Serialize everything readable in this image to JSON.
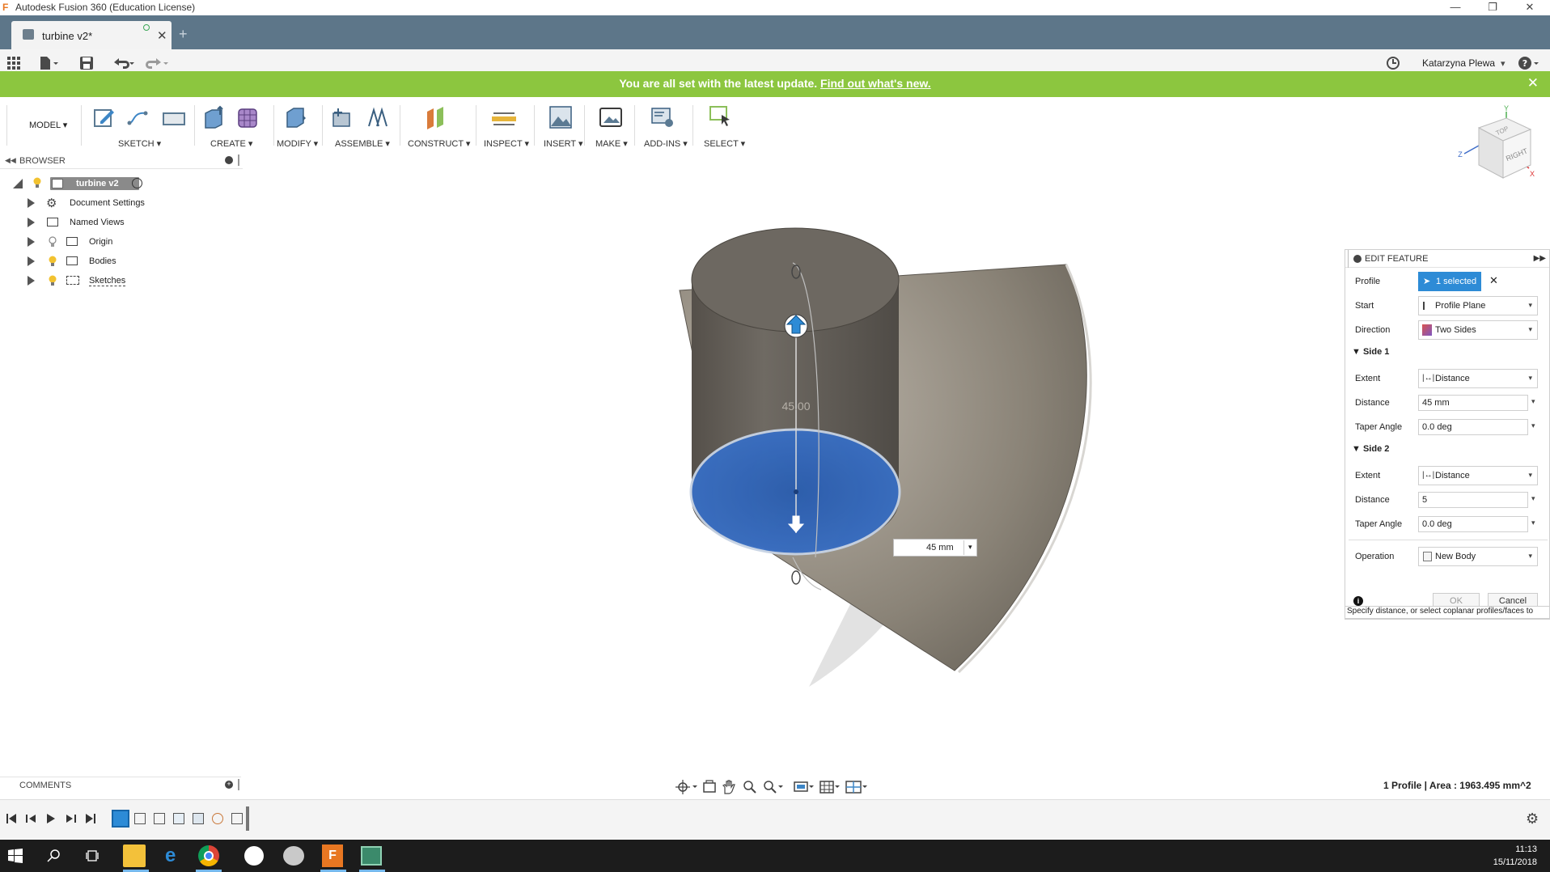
{
  "window": {
    "title": "Autodesk Fusion 360 (Education License)",
    "app_icon": "F"
  },
  "tab": {
    "label": "turbine v2*"
  },
  "user": {
    "name": "Katarzyna Plewa"
  },
  "banner": {
    "text": "You are all set with the latest update.",
    "link": "Find out what's new."
  },
  "toolbar": {
    "workspace": "MODEL",
    "groups": [
      "SKETCH",
      "CREATE",
      "MODIFY",
      "ASSEMBLE",
      "CONSTRUCT",
      "INSPECT",
      "INSERT",
      "MAKE",
      "ADD-INS",
      "SELECT"
    ]
  },
  "browser": {
    "title": "BROWSER",
    "root": "turbine v2",
    "items": [
      "Document Settings",
      "Named Views",
      "Origin",
      "Bodies",
      "Sketches"
    ]
  },
  "viewport": {
    "dimension_label": "45.00",
    "distance_input": "45 mm",
    "viewcube_face": "RIGHT",
    "viewcube_top": "TOP",
    "axis_labels": [
      "Y",
      "Z",
      "X"
    ]
  },
  "edit_feature": {
    "title": "EDIT FEATURE",
    "profile_label": "Profile",
    "profile_value": "1 selected",
    "start_label": "Start",
    "start_value": "Profile Plane",
    "direction_label": "Direction",
    "direction_value": "Two Sides",
    "side1": {
      "title": "Side 1",
      "extent_label": "Extent",
      "extent_value": "Distance",
      "distance_label": "Distance",
      "distance_value": "45 mm",
      "taper_label": "Taper Angle",
      "taper_value": "0.0 deg"
    },
    "side2": {
      "title": "Side 2",
      "extent_label": "Extent",
      "extent_value": "Distance",
      "distance_label": "Distance",
      "distance_value": "5",
      "taper_label": "Taper Angle",
      "taper_value": "0.0 deg"
    },
    "operation_label": "Operation",
    "operation_value": "New Body",
    "ok_label": "OK",
    "cancel_label": "Cancel",
    "hint": "Specify distance, or select coplanar profiles/faces to"
  },
  "comments": {
    "title": "COMMENTS"
  },
  "status": {
    "text": "1 Profile | Area : 1963.495 mm^2"
  },
  "taskbar": {
    "time": "11:13",
    "date": "15/11/2018"
  },
  "colors": {
    "tabbar": "#5d7689",
    "banner": "#8cc63f",
    "accent": "#2d8bd6",
    "profile_fill": "#2c64b8",
    "solid": "#7a736b"
  }
}
